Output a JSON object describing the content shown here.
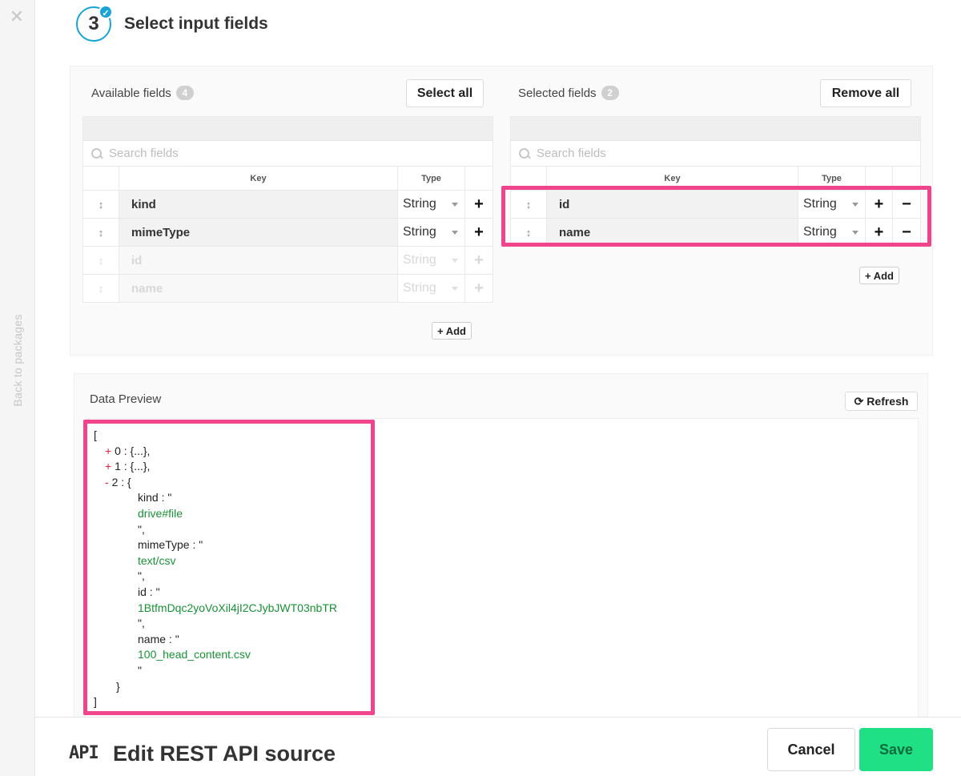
{
  "rail": {
    "close_icon": "close-icon",
    "back_label": "Back to packages"
  },
  "step": {
    "number": "3",
    "check_icon": "check-icon",
    "title": "Select input fields"
  },
  "available": {
    "label": "Available fields",
    "count": "4",
    "select_all_label": "Select all",
    "search_placeholder": "Search fields",
    "columns": {
      "key": "Key",
      "type": "Type"
    },
    "rows": [
      {
        "key": "kind",
        "type": "String",
        "enabled": true
      },
      {
        "key": "mimeType",
        "type": "String",
        "enabled": true
      },
      {
        "key": "id",
        "type": "String",
        "enabled": false
      },
      {
        "key": "name",
        "type": "String",
        "enabled": false
      }
    ],
    "add_label": "+ Add"
  },
  "selected": {
    "label": "Selected fields",
    "count": "2",
    "remove_all_label": "Remove all",
    "search_placeholder": "Search fields",
    "columns": {
      "key": "Key",
      "type": "Type"
    },
    "rows": [
      {
        "key": "id",
        "type": "String"
      },
      {
        "key": "name",
        "type": "String"
      }
    ],
    "add_label": "+ Add"
  },
  "preview": {
    "title": "Data Preview",
    "refresh_label": "Refresh",
    "lines": [
      {
        "indent": 0,
        "text": "["
      },
      {
        "indent": 1,
        "pm": "+",
        "text": "0 : {...},"
      },
      {
        "indent": 1,
        "pm": "+",
        "text": "1 : {...},"
      },
      {
        "indent": 1,
        "pm": "-",
        "text": "2 : {"
      },
      {
        "indent": 3,
        "text": "kind : \""
      },
      {
        "indent": 3,
        "str": "drive#file"
      },
      {
        "indent": 3,
        "text": "\","
      },
      {
        "indent": 3,
        "text": "mimeType : \""
      },
      {
        "indent": 3,
        "str": "text/csv"
      },
      {
        "indent": 3,
        "text": "\","
      },
      {
        "indent": 3,
        "text": "id : \""
      },
      {
        "indent": 3,
        "str": "1BtfmDqc2yoVoXil4jI2CJybJWT03nbTR"
      },
      {
        "indent": 3,
        "text": "\","
      },
      {
        "indent": 3,
        "text": "name : \""
      },
      {
        "indent": 3,
        "str": "100_head_content.csv"
      },
      {
        "indent": 3,
        "text": "\""
      },
      {
        "indent": 2,
        "text": "}"
      },
      {
        "indent": 0,
        "text": "]"
      }
    ]
  },
  "footer": {
    "logo_text": "API",
    "title": "Edit REST API source",
    "cancel_label": "Cancel",
    "save_label": "Save",
    "save_color": "#1fe085"
  },
  "highlight_color": "#f0458d",
  "accent_color": "#19a3d6"
}
